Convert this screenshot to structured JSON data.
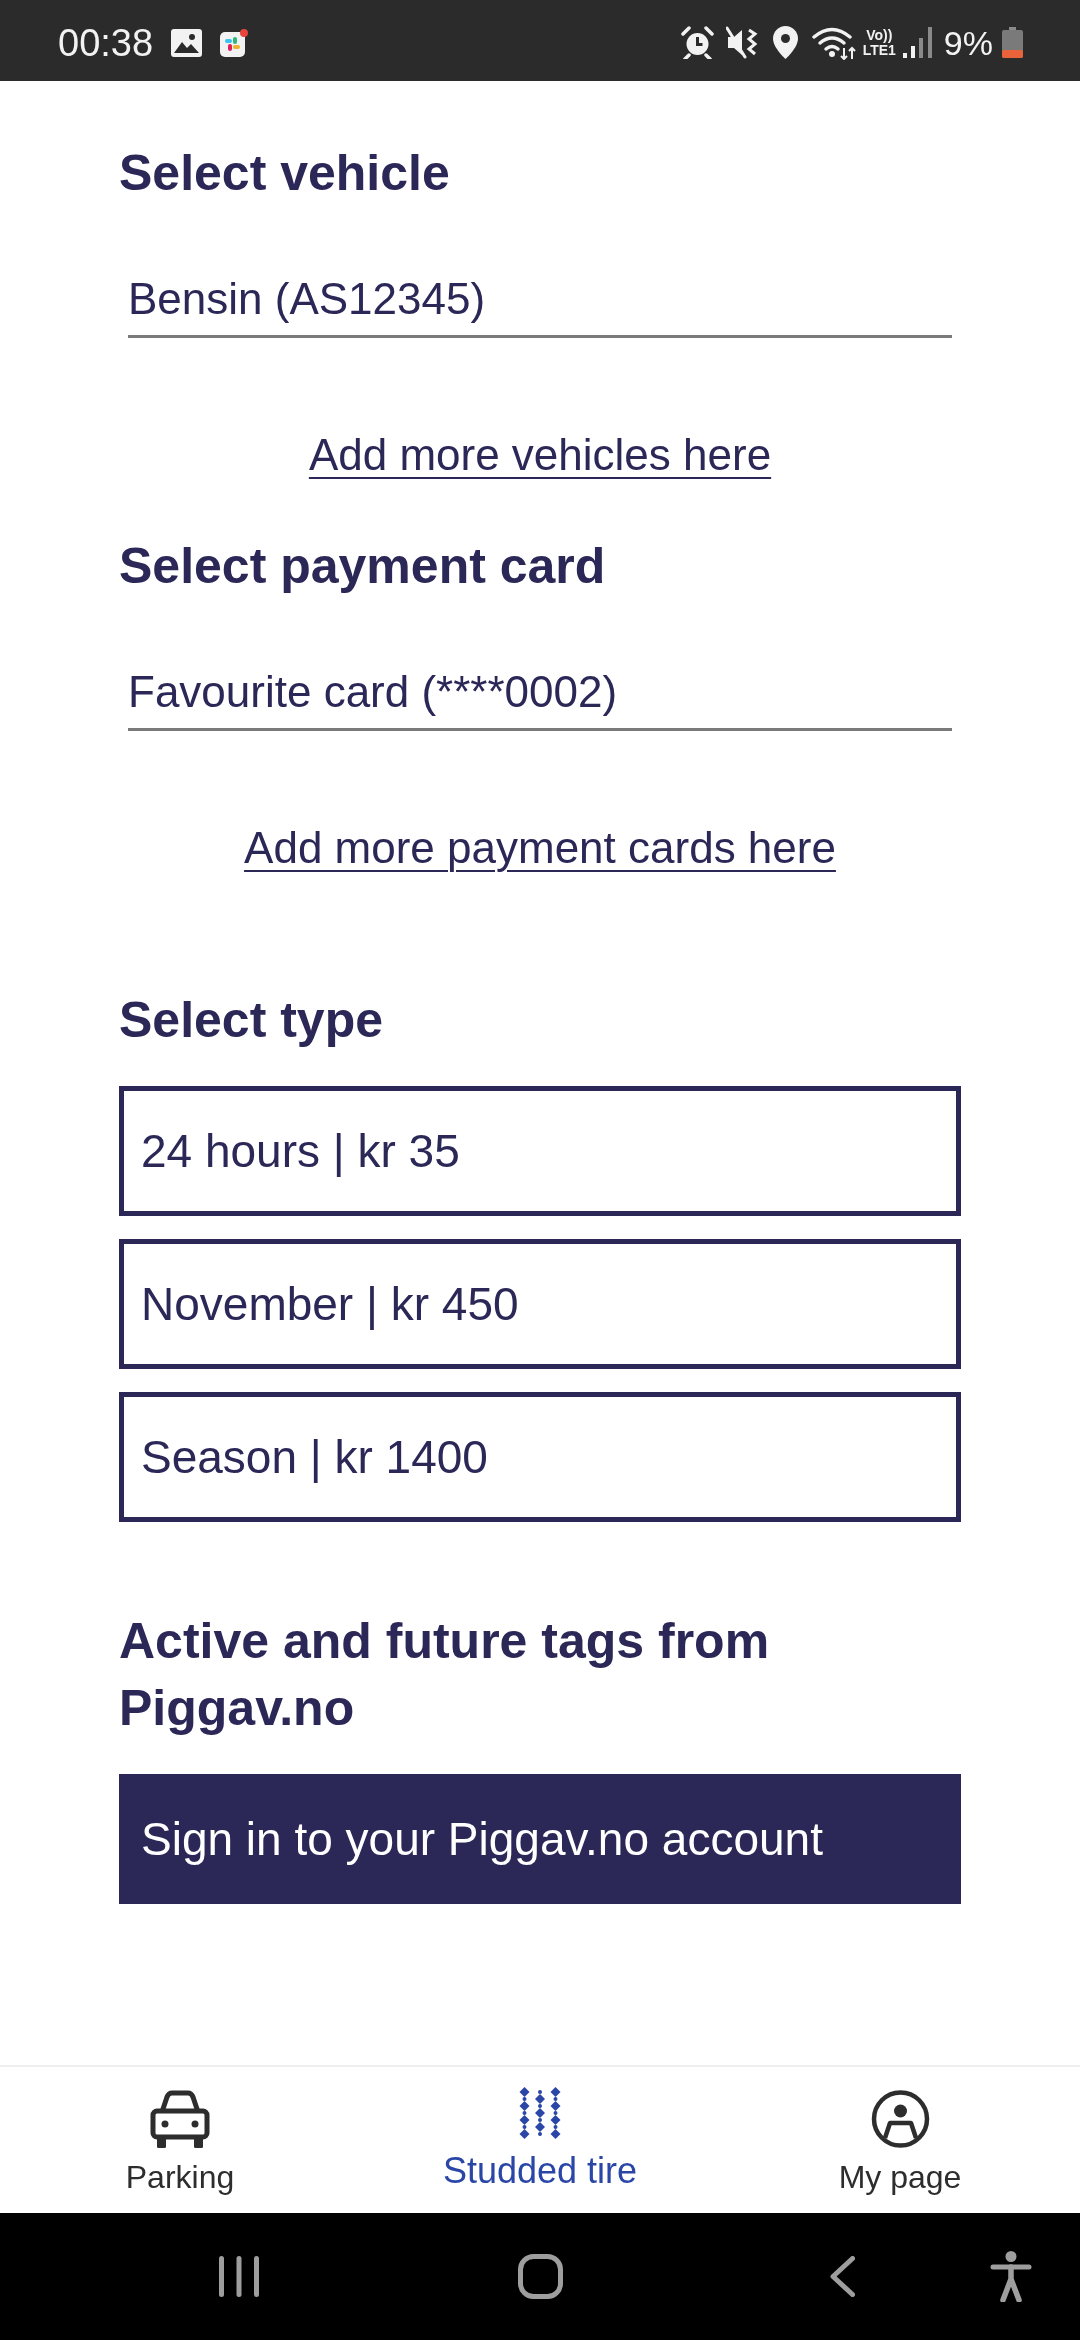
{
  "status_bar": {
    "time": "00:38",
    "network_top": "Vo))",
    "network_bottom": "LTE1",
    "battery": "9%"
  },
  "sections": [
    {
      "kind": "select",
      "heading": "Select vehicle",
      "value": "Bensin (AS12345)",
      "link": "Add more vehicles here"
    },
    {
      "kind": "select",
      "heading": "Select payment card",
      "value": "Favourite card (****0002)",
      "link": "Add more payment cards here"
    },
    {
      "kind": "options",
      "heading": "Select type",
      "options": [
        {
          "label": "24 hours | kr 35",
          "selected": false
        },
        {
          "label": "November | kr 450",
          "selected": false
        },
        {
          "label": "Season | kr 1400",
          "selected": false
        }
      ]
    },
    {
      "kind": "action",
      "heading": "Active and future tags from Piggav.no",
      "button": "Sign in to your Piggav.no account"
    }
  ],
  "bottom_nav": [
    {
      "label": "Parking",
      "selected": false
    },
    {
      "label": "Studded tire",
      "selected": true
    },
    {
      "label": "My page",
      "selected": false
    }
  ]
}
